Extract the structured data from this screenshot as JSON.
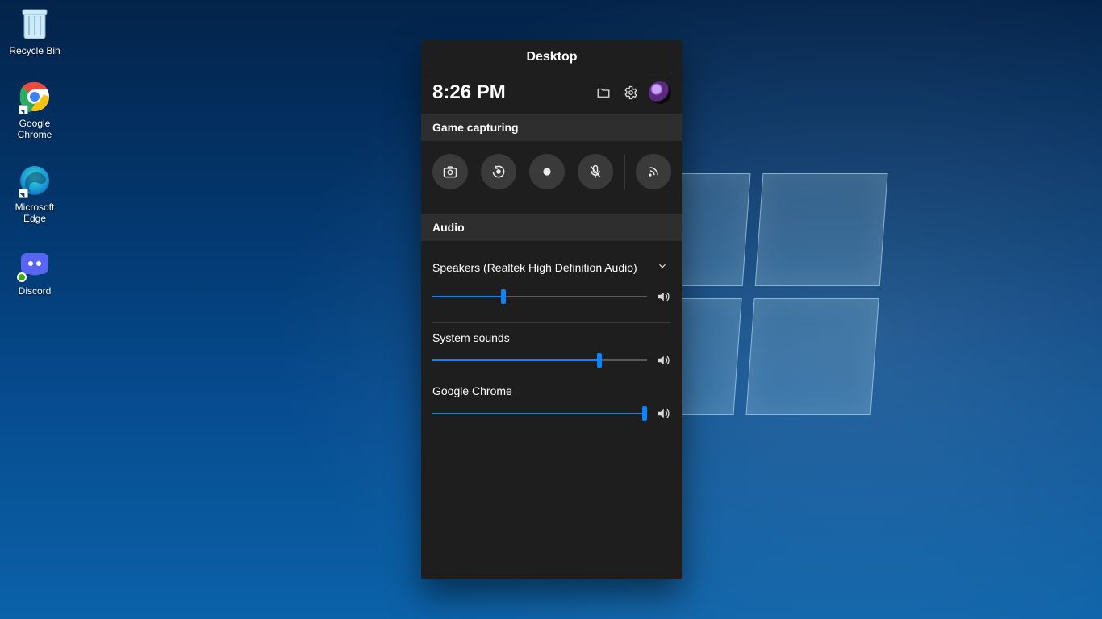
{
  "desktop_icons": [
    {
      "id": "recycle-bin",
      "label": "Recycle Bin"
    },
    {
      "id": "google-chrome",
      "label": "Google Chrome"
    },
    {
      "id": "microsoft-edge",
      "label": "Microsoft Edge"
    },
    {
      "id": "discord",
      "label": "Discord"
    }
  ],
  "gamebar": {
    "title": "Desktop",
    "time": "8:26 PM",
    "sections": {
      "capture": "Game capturing",
      "audio": "Audio"
    },
    "audio": {
      "device_label": "Speakers (Realtek High Definition Audio)",
      "device_volume_percent": 33,
      "apps": [
        {
          "name": "System sounds",
          "volume_percent": 78
        },
        {
          "name": "Google Chrome",
          "volume_percent": 99
        }
      ]
    }
  },
  "colors": {
    "accent": "#0a84ff"
  }
}
